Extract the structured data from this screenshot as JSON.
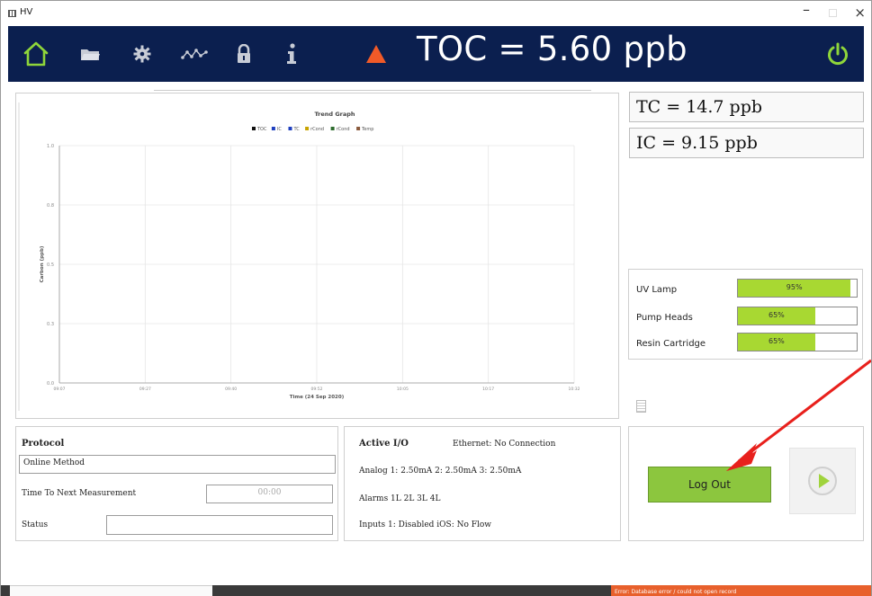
{
  "window": {
    "title": "HV",
    "minimize": "–",
    "close": "×"
  },
  "header": {
    "toc_reading": "TOC = 5.60 ppb",
    "icons": [
      "home-icon",
      "folder-icon",
      "gear-icon",
      "trend-icon",
      "lock-icon",
      "info-icon",
      "warning-icon",
      "power-icon"
    ],
    "colors": {
      "background": "#0b1f4f",
      "home": "#8fd63a",
      "warning": "#f05a28",
      "power": "#8fd63a",
      "icons": "#c8ccd6"
    }
  },
  "chart_data": {
    "type": "line",
    "title": "Trend Graph",
    "legend": [
      "TOC",
      "IC",
      "TC",
      "rCond",
      "rCond",
      "Temp"
    ],
    "legend_colors": [
      "#111111",
      "#1f3fbf",
      "#1f3fbf",
      "#c8a400",
      "#2d6b2d",
      "#8a5a3c"
    ],
    "legend_placement": "top-center",
    "xlabel": "Time (24 Sep 2020)",
    "ylabel": "Carbon (ppb)",
    "x_ticks": [
      "09:07",
      "09:27",
      "09:40",
      "09:52",
      "10:05",
      "10:17",
      "10:32"
    ],
    "y_ticks": [
      "0.0",
      "0.3",
      "0.5",
      "0.8",
      "1.0"
    ],
    "ylim": [
      0,
      1.0
    ],
    "grid": true,
    "series": []
  },
  "readings": {
    "tc": "TC = 14.7 ppb",
    "ic": "IC = 9.15 ppb"
  },
  "consumables": [
    {
      "label": "UV Lamp",
      "percent": 95,
      "text": "95%"
    },
    {
      "label": "Pump Heads",
      "percent": 65,
      "text": "65%"
    },
    {
      "label": "Resin Cartridge",
      "percent": 65,
      "text": "65%"
    }
  ],
  "protocol": {
    "heading": "Protocol",
    "method": "Online Method",
    "next_label": "Time To Next Measurement",
    "next_value": "00:00",
    "status_label": "Status",
    "status_value": ""
  },
  "active_io": {
    "heading": "Active I/O",
    "ethernet": "Ethernet: No Connection",
    "analog": "Analog 1: 2.50mA  2: 2.50mA  3: 2.50mA",
    "alarms": "Alarms 1L 2L 3L 4L",
    "inputs": "Inputs 1: Disabled  iOS: No Flow"
  },
  "actions": {
    "logout": "Log Out"
  },
  "taskbar": {
    "error": "Error: Database error / could not open record"
  }
}
